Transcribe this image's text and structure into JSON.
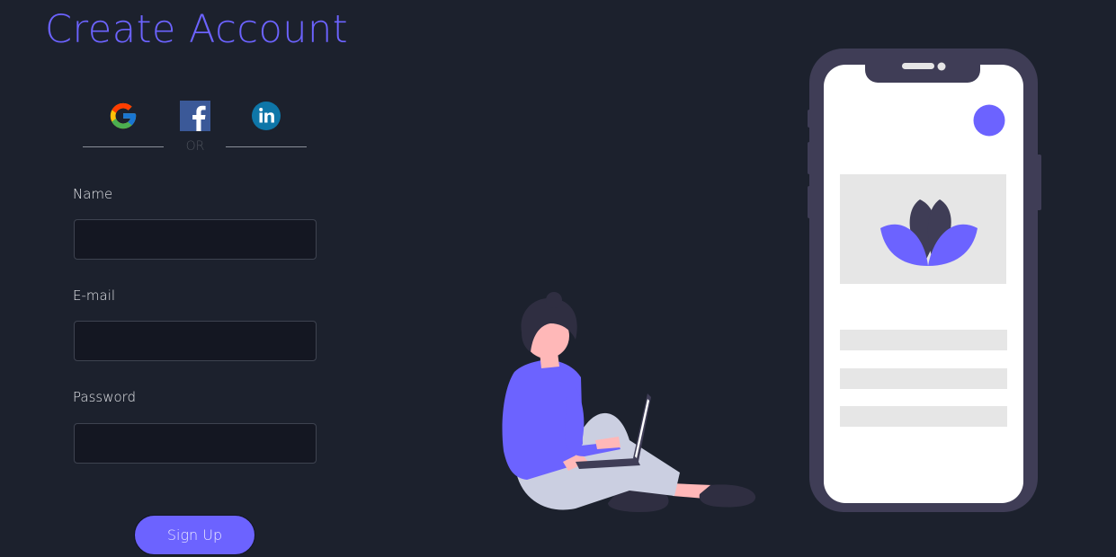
{
  "form": {
    "title": "Create Account",
    "social": {
      "google_icon": "google-icon",
      "facebook_icon": "facebook-icon",
      "linkedin_icon": "linkedin-icon",
      "divider_text": "OR"
    },
    "fields": [
      {
        "label": "Name",
        "value": "",
        "placeholder": ""
      },
      {
        "label": "E-mail",
        "value": "",
        "placeholder": ""
      },
      {
        "label": "Password",
        "value": "",
        "placeholder": ""
      }
    ],
    "submit_label": "Sign Up"
  },
  "colors": {
    "background": "#1c212d",
    "accent": "#6c63ff",
    "input_bg": "#141722",
    "phone_frame": "#3f3d56"
  }
}
